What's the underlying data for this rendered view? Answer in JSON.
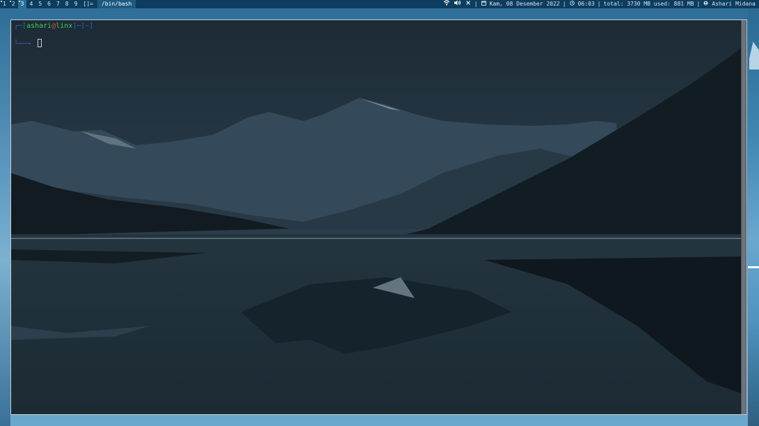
{
  "topbar": {
    "tags": [
      {
        "label": "1",
        "occupied": true,
        "selected": false
      },
      {
        "label": "2",
        "occupied": true,
        "selected": false
      },
      {
        "label": "3",
        "occupied": true,
        "selected": true
      },
      {
        "label": "4",
        "occupied": false,
        "selected": false
      },
      {
        "label": "5",
        "occupied": false,
        "selected": false
      },
      {
        "label": "6",
        "occupied": false,
        "selected": false
      },
      {
        "label": "7",
        "occupied": false,
        "selected": false
      },
      {
        "label": "8",
        "occupied": false,
        "selected": false
      },
      {
        "label": "9",
        "occupied": false,
        "selected": false
      }
    ],
    "layout_symbol": "[]=",
    "window_title": "/bin/bash",
    "status": {
      "date": "Kam, 08 Desember 2022",
      "time": "06:03",
      "memory": "total: 3730 MB used: 881 MB",
      "user": "Ashari Midana",
      "separator": "|"
    },
    "icons": [
      "wifi-icon",
      "volume-icon",
      "mute-icon",
      "calendar-icon",
      "clock-icon",
      "user-icon"
    ]
  },
  "terminal": {
    "prompt": {
      "open": "┌─[",
      "user": "ashari",
      "at": "@",
      "host": "linx",
      "dir_sep": "]─[",
      "dir": "~",
      "close": "]",
      "line2": "└──╼"
    }
  },
  "colors": {
    "bar_bg": "#0d3d5e",
    "selected_tag": "#2b6f98",
    "prompt_green": "#3fd14a",
    "prompt_red": "#d84a4a",
    "prompt_blue": "#3c5fa8"
  }
}
